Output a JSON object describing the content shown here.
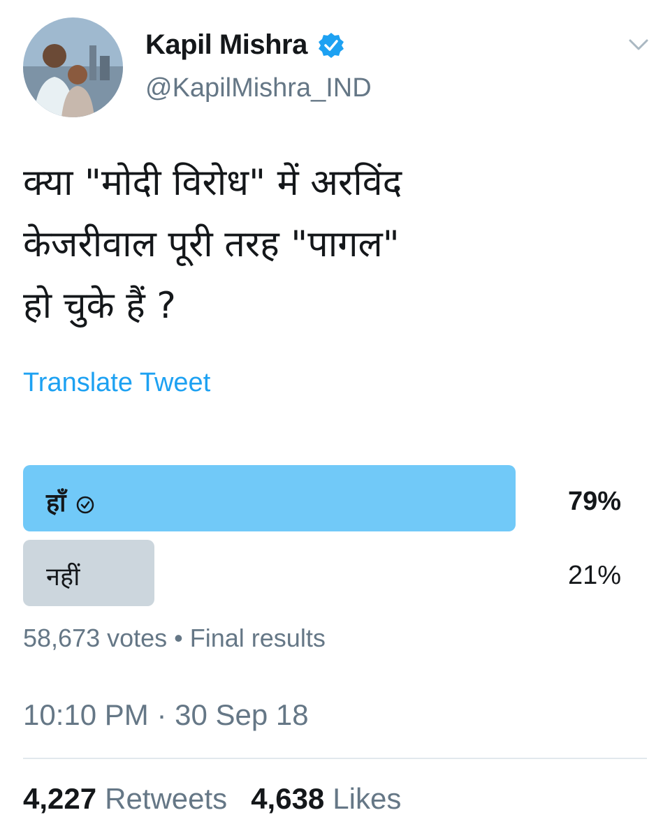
{
  "tweet": {
    "author_name": "Kapil Mishra",
    "handle": "@KapilMishra_IND",
    "text": "क्या \"मोदी विरोध\" में  अरविंद\nकेजरीवाल पूरी तरह \"पागल\"\nहो चुके हैं ?",
    "translate_label": "Translate Tweet",
    "timestamp": "10:10 PM · 30 Sep 18"
  },
  "poll": {
    "options": [
      {
        "label": "हाँ",
        "percent_text": "79%",
        "fraction": 0.79,
        "color": "#71c9f8",
        "winner": true
      },
      {
        "label": "नहीं",
        "percent_text": "21%",
        "fraction": 0.21,
        "color": "#ccd6dd",
        "winner": false
      }
    ],
    "summary": "58,673 votes • Final results"
  },
  "stats": {
    "retweets_count": "4,227",
    "retweets_label": "Retweets",
    "likes_count": "4,638",
    "likes_label": "Likes"
  },
  "colors": {
    "accent": "#1da1f2",
    "muted": "#657786"
  },
  "icons": {
    "verified": "verified-badge-icon",
    "chevron": "chevron-down-icon",
    "check": "check-circle-icon"
  }
}
